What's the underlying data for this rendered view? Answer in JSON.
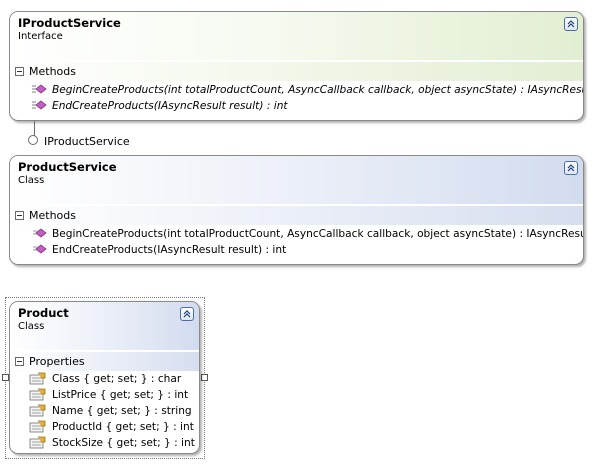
{
  "interface_shape": {
    "title": "IProductService",
    "type": "Interface",
    "compartment_label": "Methods",
    "members": [
      "BeginCreateProducts(int totalProductCount, AsyncCallback callback, object asyncState) : IAsyncResult",
      "EndCreateProducts(IAsyncResult result) : int"
    ]
  },
  "lollipop": {
    "label": "IProductService"
  },
  "class_shape": {
    "title": "ProductService",
    "type": "Class",
    "compartment_label": "Methods",
    "members": [
      "BeginCreateProducts(int totalProductCount, AsyncCallback callback, object asyncState) : IAsyncResult",
      "EndCreateProducts(IAsyncResult result) : int"
    ]
  },
  "product_shape": {
    "title": "Product",
    "type": "Class",
    "compartment_label": "Properties",
    "members": [
      "Class { get; set; } : char",
      "ListPrice { get; set; } : int",
      "Name { get; set; } : string",
      "ProductId { get; set; } : int",
      "StockSize { get; set; } : int"
    ]
  },
  "icons": {
    "collapse": "double-chevron-up-icon",
    "method": "method-icon",
    "property": "property-icon",
    "toggle": "minus-toggle-icon"
  },
  "colors": {
    "interface_header": "#e2eed2",
    "class_header": "#d2dcef",
    "method_icon": "#c060c0",
    "property_icon": "#e0b040",
    "border": "#8a8a8a"
  }
}
